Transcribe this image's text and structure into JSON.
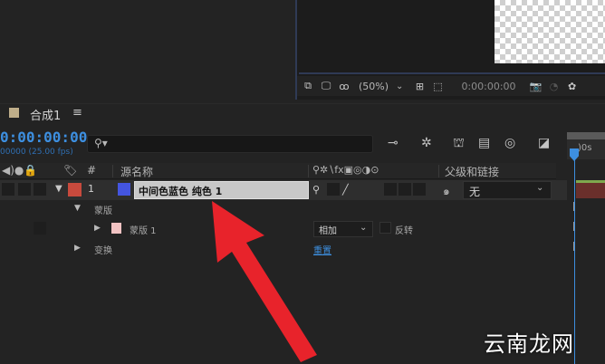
{
  "viewer": {
    "zoom": "(50%)",
    "timecode": "0:00:00:00"
  },
  "comp_tab": {
    "label": "合成1",
    "menu_icon": "≡"
  },
  "timeline": {
    "current_time": "0:00:00:00",
    "fps_label": "00000 (25.00 fps)",
    "search_placeholder": "",
    "ruler_label": ")0s"
  },
  "header": {
    "num_col": "#",
    "source_name": "源名称",
    "parent_link": "父级和链接"
  },
  "layer": {
    "number": "1",
    "name": "中间色蓝色 纯色 1",
    "parent_value": "无",
    "label_color": "#c84a3d",
    "solid_color": "#4455e0"
  },
  "masks_group": {
    "label": "蒙版",
    "mask_name": "蒙版 1",
    "blend_mode": "相加",
    "invert_label": "反转"
  },
  "transform": {
    "label": "变换",
    "reset_label": "重置"
  },
  "watermark": "云南龙网",
  "colors": {
    "accent_blue": "#3d8fe0",
    "arrow_red": "#e8232b"
  }
}
